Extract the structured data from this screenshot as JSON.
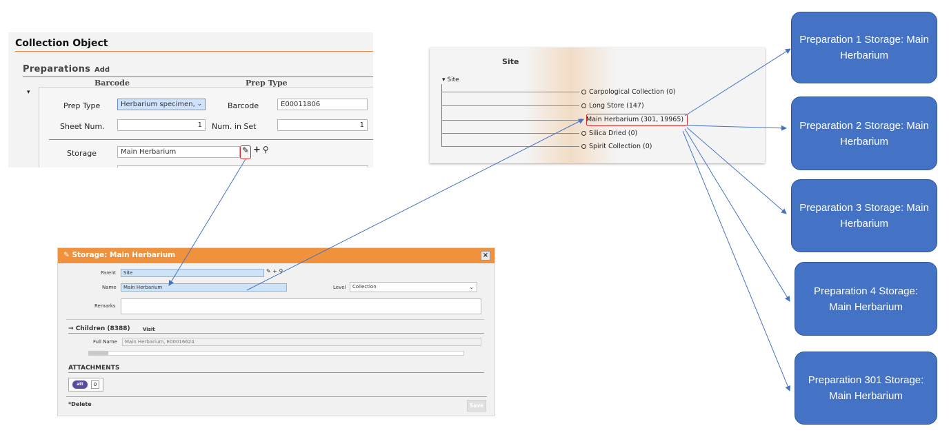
{
  "collection_object": {
    "title": "Collection Object",
    "preparations_label": "Preparations",
    "add_label": "Add",
    "col_barcode": "Barcode",
    "col_prep_type": "Prep Type",
    "caret": "▾",
    "prep_type_label": "Prep Type",
    "prep_type_value": "Herbarium specimen,",
    "barcode_label": "Barcode",
    "barcode_value": "E00011806",
    "sheet_num_label": "Sheet Num.",
    "sheet_num_value": "1",
    "num_in_set_label": "Num. in Set",
    "num_in_set_value": "1",
    "storage_label": "Storage",
    "storage_value": "Main Herbarium"
  },
  "site_tree": {
    "title": "Site",
    "root": "▾ Site",
    "nodes": [
      "Carpological Collection (0)",
      "Long Store (147)",
      "Main Herbarium (301, 19965)",
      "Silica Dried (0)",
      "Spirit Collection (0)"
    ]
  },
  "storage_dialog": {
    "title": "Storage: Main Herbarium",
    "close": "×",
    "parent_label": "Parent",
    "parent_value": "Site",
    "name_label": "Name",
    "name_value": "Main Herbarium",
    "level_label": "Level",
    "level_value": "Collection",
    "remarks_label": "Remarks",
    "children_label": "Children (8388)",
    "children_arrow": "→",
    "visit_label": "Visit",
    "full_name_label": "Full Name",
    "full_name_value": "Main Herbarium, E00016624",
    "attachments_label": "ATTACHMENTS",
    "attachments_count": "0",
    "delete_label": "*Delete",
    "save_label": "Save"
  },
  "callouts": [
    "Preparation 1 Storage: Main Herbarium",
    "Preparation 2 Storage: Main Herbarium",
    "Preparation 3 Storage: Main Herbarium",
    "Preparation 4 Storage: Main Herbarium",
    "Preparation 301 Storage: Main Herbarium"
  ],
  "colors": {
    "accent_orange": "#f0913d",
    "callout_blue": "#4472c4",
    "highlight_red": "#d52b2b",
    "arrow_blue": "#4472c4"
  }
}
